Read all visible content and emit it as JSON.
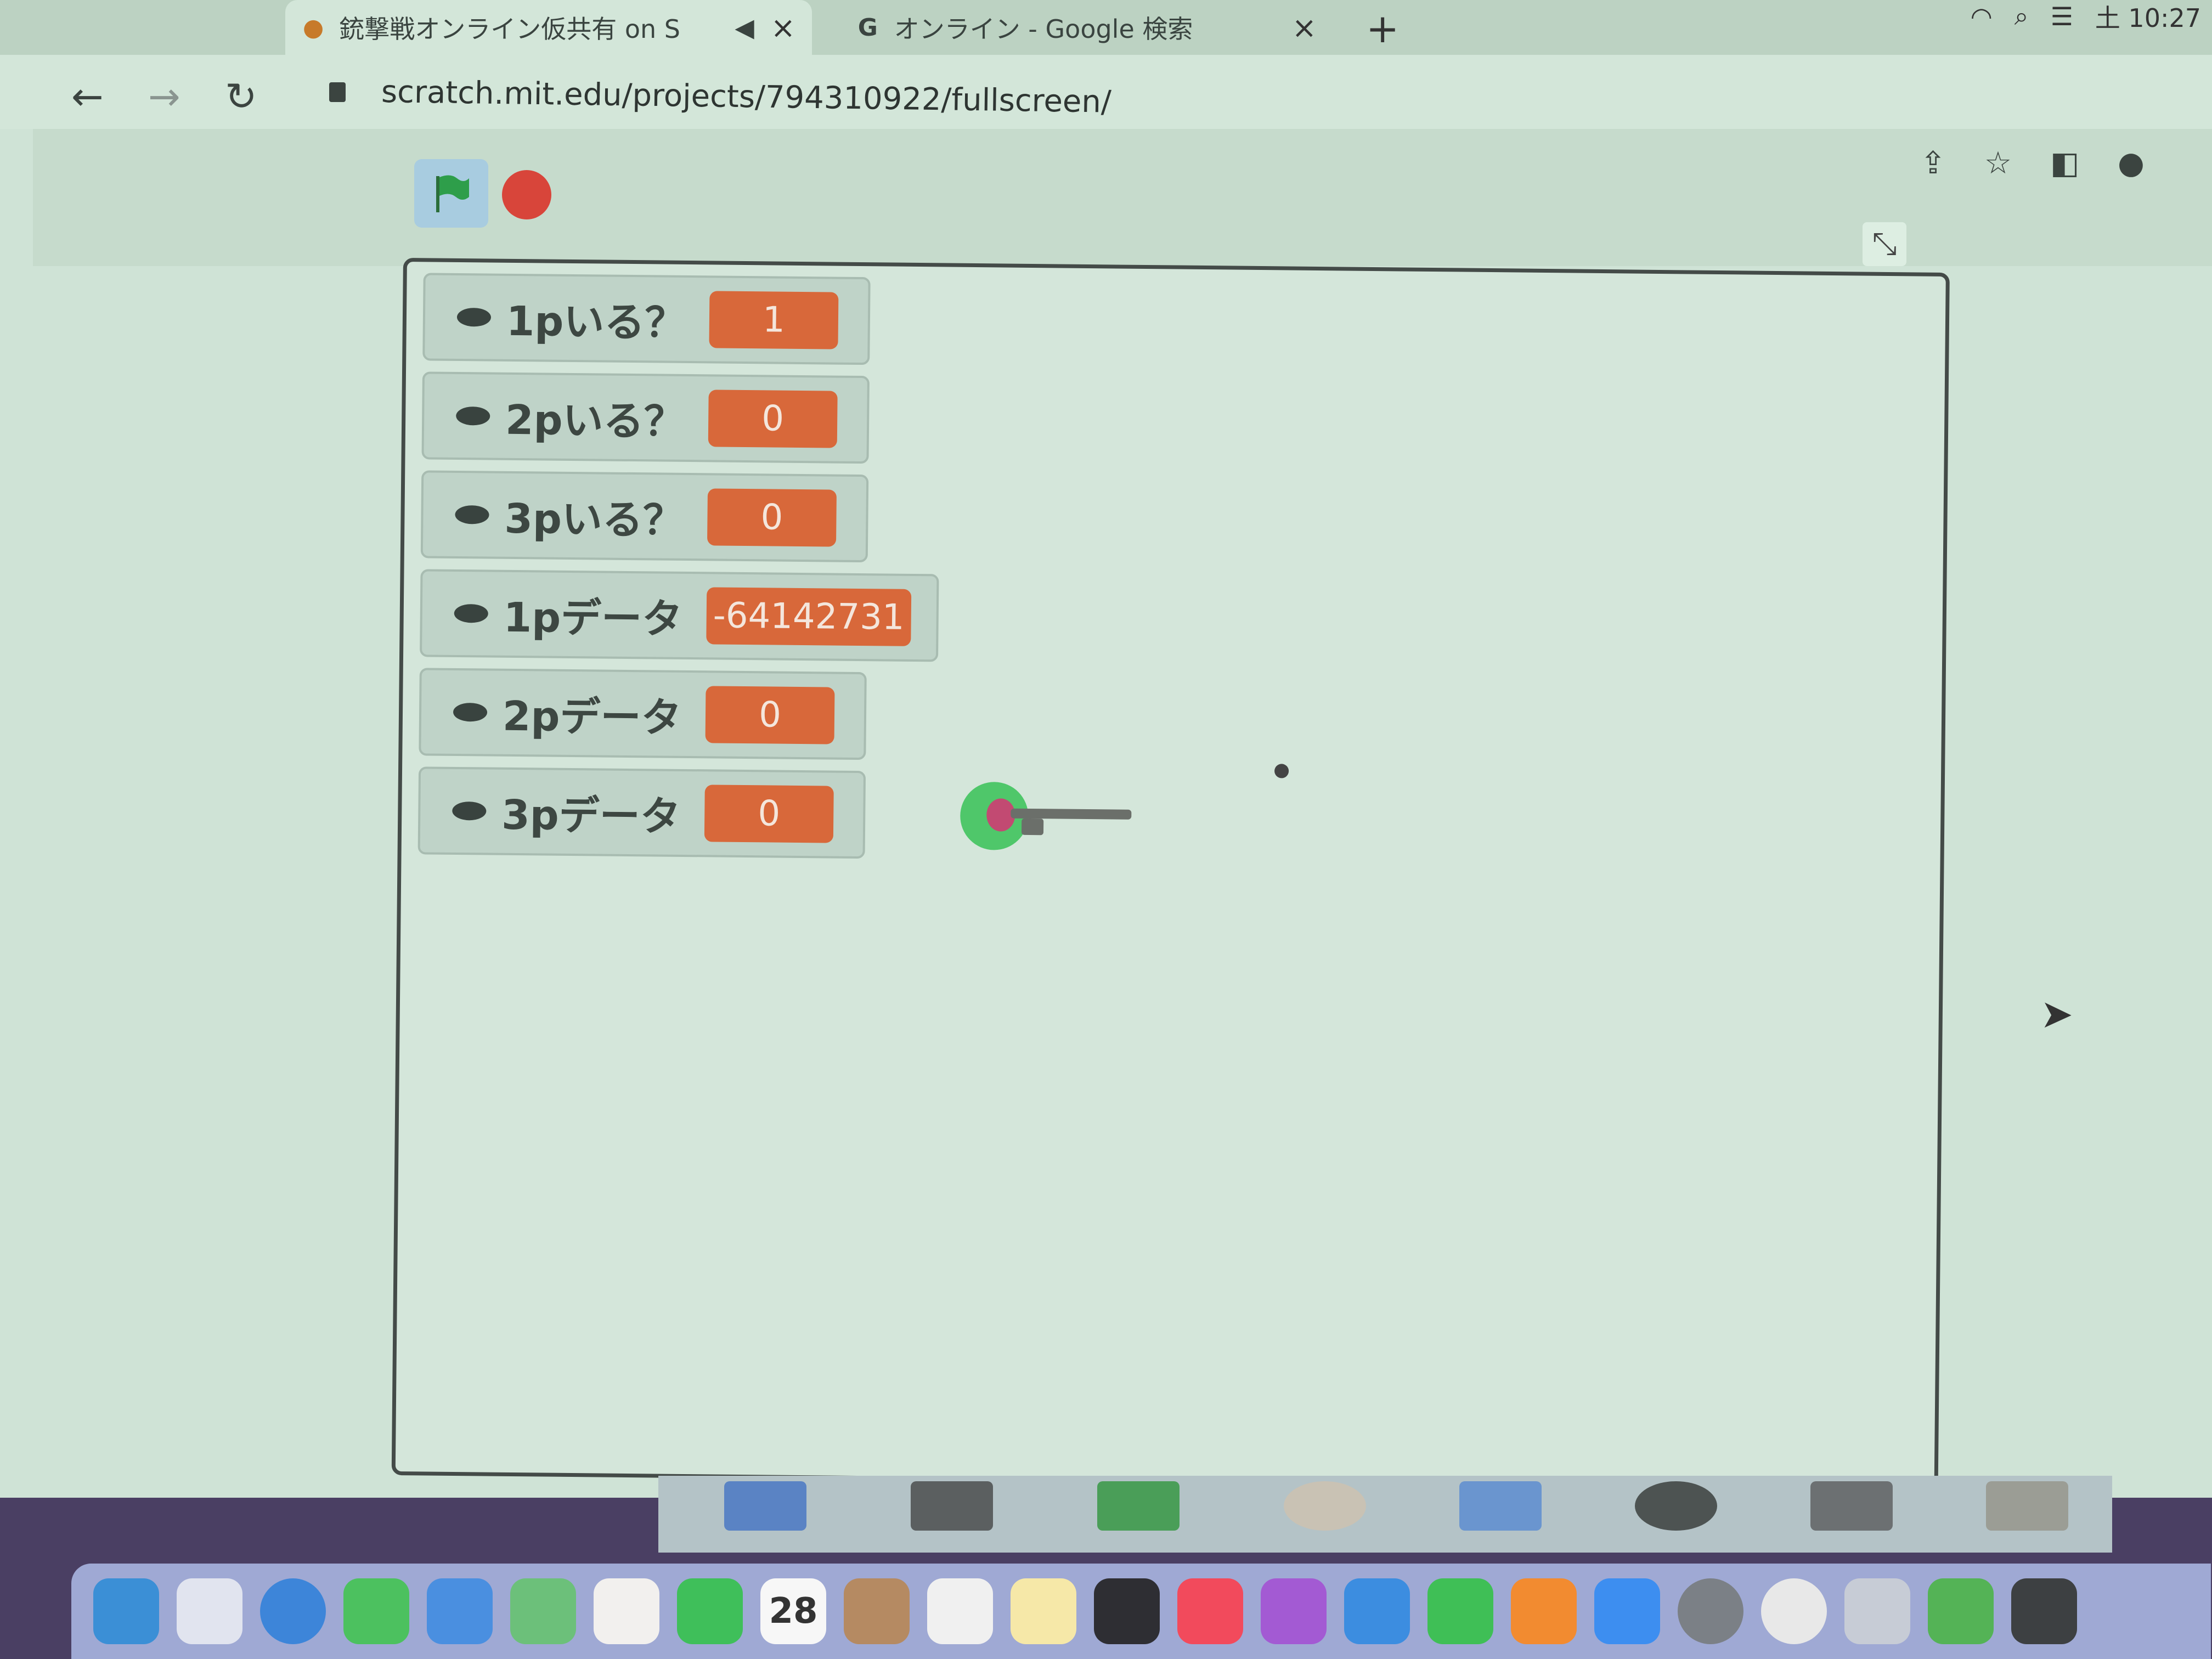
{
  "browser": {
    "tabs": [
      {
        "title": "銃撃戦オンライン仮共有 on S",
        "active": true
      },
      {
        "title": "オンライン - Google 検索",
        "active": false
      }
    ],
    "new_tab_label": "+",
    "clock": "土 10:27",
    "url": "scratch.mit.edu/projects/794310922/fullscreen/"
  },
  "scratch": {
    "monitors": [
      {
        "name": "1pいる？",
        "value": "1"
      },
      {
        "name": "2pいる？",
        "value": "0"
      },
      {
        "name": "3pいる？",
        "value": "0"
      },
      {
        "name": "1pデータ",
        "value": "-64142731"
      },
      {
        "name": "2pデータ",
        "value": "0"
      },
      {
        "name": "3pデータ",
        "value": "0"
      }
    ]
  },
  "dock": {
    "calendar_date": "28",
    "icons": [
      "finder-icon",
      "launchpad-icon",
      "safari-icon",
      "messages-icon",
      "mail-icon",
      "maps-icon",
      "photos-icon",
      "facetime-icon",
      "calendar-icon",
      "contacts-icon",
      "reminders-icon",
      "notes-icon",
      "tv-icon",
      "music-icon",
      "podcasts-icon",
      "keynote-icon",
      "numbers-icon",
      "pages-icon",
      "app-store-icon",
      "system-preferences-icon",
      "chrome-icon",
      "script-editor-icon",
      "scratch-icon",
      "terminal-icon"
    ]
  },
  "colors": {
    "monitor_value": "#d8683a",
    "stop": "#d8453a",
    "flag": "#2e9e4a"
  }
}
